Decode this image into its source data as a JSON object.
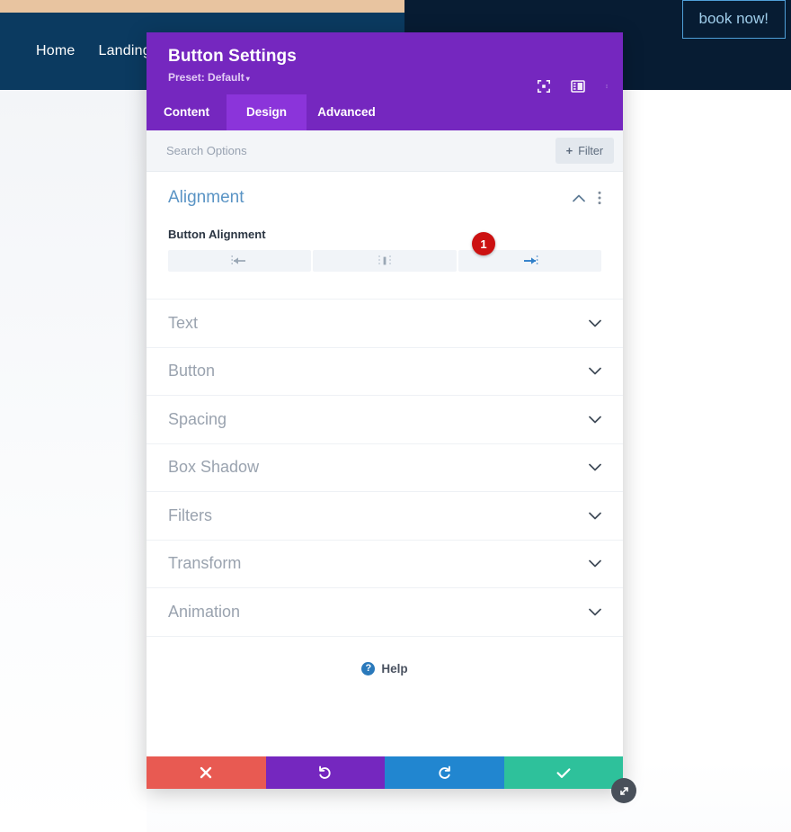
{
  "site": {
    "nav_links": [
      "Home",
      "Landing"
    ],
    "cta_label": "book now!",
    "colors": {
      "nav_left": "#0b3a60",
      "nav_right": "#071c33",
      "top_strip": "#e8c4a0",
      "cta_border": "#4f9fd8"
    }
  },
  "modal": {
    "title": "Button Settings",
    "preset_label": "Preset: Default",
    "preset_caret": "▾",
    "header_icons": [
      {
        "name": "focus-target-icon"
      },
      {
        "name": "layout-panel-icon"
      },
      {
        "name": "more-options-icon"
      }
    ],
    "tabs": [
      {
        "label": "Content",
        "active": false
      },
      {
        "label": "Design",
        "active": true
      },
      {
        "label": "Advanced",
        "active": false
      }
    ],
    "search": {
      "placeholder": "Search Options",
      "value": ""
    },
    "filter_button": {
      "label": "Filter",
      "plus": "+"
    },
    "group": {
      "title": "Alignment",
      "expanded": true,
      "field": {
        "label": "Button Alignment",
        "options": [
          {
            "name": "align-left",
            "selected": false
          },
          {
            "name": "align-center",
            "selected": false
          },
          {
            "name": "align-right",
            "selected": true
          }
        ],
        "badge": "1"
      }
    },
    "sections": [
      {
        "label": "Text"
      },
      {
        "label": "Button"
      },
      {
        "label": "Spacing"
      },
      {
        "label": "Box Shadow"
      },
      {
        "label": "Filters"
      },
      {
        "label": "Transform"
      },
      {
        "label": "Animation"
      }
    ],
    "help": {
      "icon_glyph": "?",
      "label": "Help"
    },
    "footer": [
      {
        "name": "cancel-button",
        "icon": "close-icon",
        "color": "#e85a52"
      },
      {
        "name": "undo-button",
        "icon": "undo-icon",
        "color": "#7527bf"
      },
      {
        "name": "redo-button",
        "icon": "redo-icon",
        "color": "#2186d0"
      },
      {
        "name": "save-button",
        "icon": "check-icon",
        "color": "#2ec19b"
      }
    ],
    "accent_color": "#7527bf"
  }
}
